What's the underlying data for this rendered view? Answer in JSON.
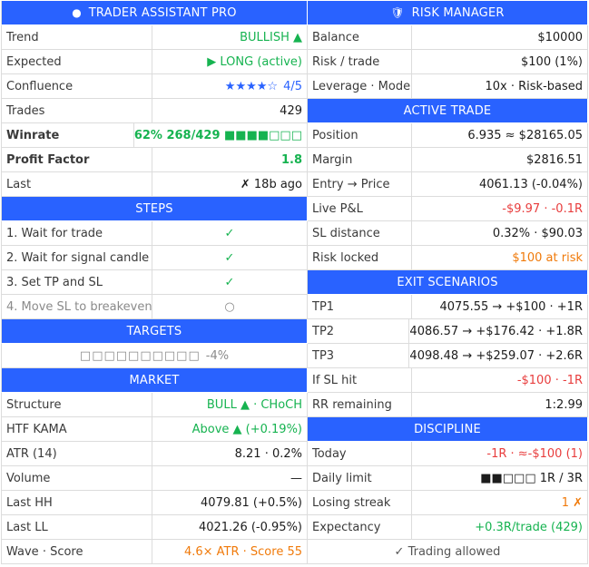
{
  "left": {
    "title_icon": "●",
    "title": "TRADER ASSISTANT PRO",
    "rows": [
      {
        "label": "Trend",
        "value": "BULLISH ▲",
        "color": "green"
      },
      {
        "label": "Expected",
        "value": "▶ LONG (active)",
        "color": "green"
      },
      {
        "label": "Confluence",
        "stars": "★★★★☆",
        "score": "4/5"
      },
      {
        "label": "Trades",
        "value": "429"
      },
      {
        "label": "Winrate",
        "value": "62%  268/429  ■■■■□□□",
        "color": "green"
      },
      {
        "label": "Profit Factor",
        "value": "1.8",
        "color": "green"
      },
      {
        "label": "Last",
        "value": "✗  18b ago"
      }
    ],
    "steps_title": "STEPS",
    "steps": [
      {
        "label": "1. Wait for trade",
        "mark": "✓",
        "done": true
      },
      {
        "label": "2. Wait for signal candle",
        "mark": "✓",
        "done": true
      },
      {
        "label": "3. Set TP and SL",
        "mark": "✓",
        "done": true
      },
      {
        "label": "4. Move SL to breakeven",
        "mark": "○",
        "done": false
      }
    ],
    "targets_title": "TARGETS",
    "targets_bar": "□□□□□□□□□□",
    "targets_pct": "-4%",
    "market_title": "MARKET",
    "market": [
      {
        "label": "Structure",
        "value": "BULL ▲ · CHoCH",
        "color": "green"
      },
      {
        "label": "HTF KAMA",
        "value": "Above ▲ (+0.19%)",
        "color": "green"
      },
      {
        "label": "ATR (14)",
        "value": "8.21 · 0.2%"
      },
      {
        "label": "Volume",
        "value": "—"
      },
      {
        "label": "Last HH",
        "value": "4079.81 (+0.5%)"
      },
      {
        "label": "Last LL",
        "value": "4021.26 (-0.95%)"
      },
      {
        "label": "Wave · Score",
        "value": "4.6× ATR · Score 55",
        "color": "orange"
      }
    ]
  },
  "right": {
    "title_icon": "🛡",
    "title": "RISK MANAGER",
    "rows": [
      {
        "label": "Balance",
        "value": "$10000"
      },
      {
        "label": "Risk / trade",
        "value": "$100 (1%)"
      },
      {
        "label": "Leverage · Mode",
        "value": "10x · Risk-based"
      }
    ],
    "active_title": "ACTIVE TRADE",
    "active": [
      {
        "label": "Position",
        "value": "6.935 ≈ $28165.05"
      },
      {
        "label": "Margin",
        "value": "$2816.51"
      },
      {
        "label": "Entry → Price",
        "value": "4061.13 (-0.04%)"
      },
      {
        "label": "Live P&L",
        "value": "-$9.97 · -0.1R",
        "color": "red"
      },
      {
        "label": "SL distance",
        "value": "0.32% · $90.03"
      },
      {
        "label": "Risk locked",
        "value": "$100 at risk",
        "color": "orange"
      }
    ],
    "exit_title": "EXIT SCENARIOS",
    "exit": [
      {
        "label": "TP1",
        "value": "4075.55 → +$100 · +1R"
      },
      {
        "label": "TP2",
        "value": "4086.57 → +$176.42 · +1.8R"
      },
      {
        "label": "TP3",
        "value": "4098.48 → +$259.07 · +2.6R"
      },
      {
        "label": "If SL hit",
        "value": "-$100 · -1R",
        "color": "red"
      },
      {
        "label": "RR remaining",
        "value": "1:2.99"
      }
    ],
    "discipline_title": "DISCIPLINE",
    "discipline": [
      {
        "label": "Today",
        "value": "-1R · ≈-$100 (1)",
        "color": "red"
      },
      {
        "label": "Daily limit",
        "value": "■■□□□  1R / 3R"
      },
      {
        "label": "Losing streak",
        "value": "1 ✗",
        "color": "orange"
      },
      {
        "label": "Expectancy",
        "value": "+0.3R/trade (429)",
        "color": "green"
      }
    ],
    "status": "✓ Trading allowed"
  },
  "colors": {
    "header": "#2962ff",
    "green": "#16b350",
    "red": "#e83d3d",
    "orange": "#f07a0a"
  }
}
